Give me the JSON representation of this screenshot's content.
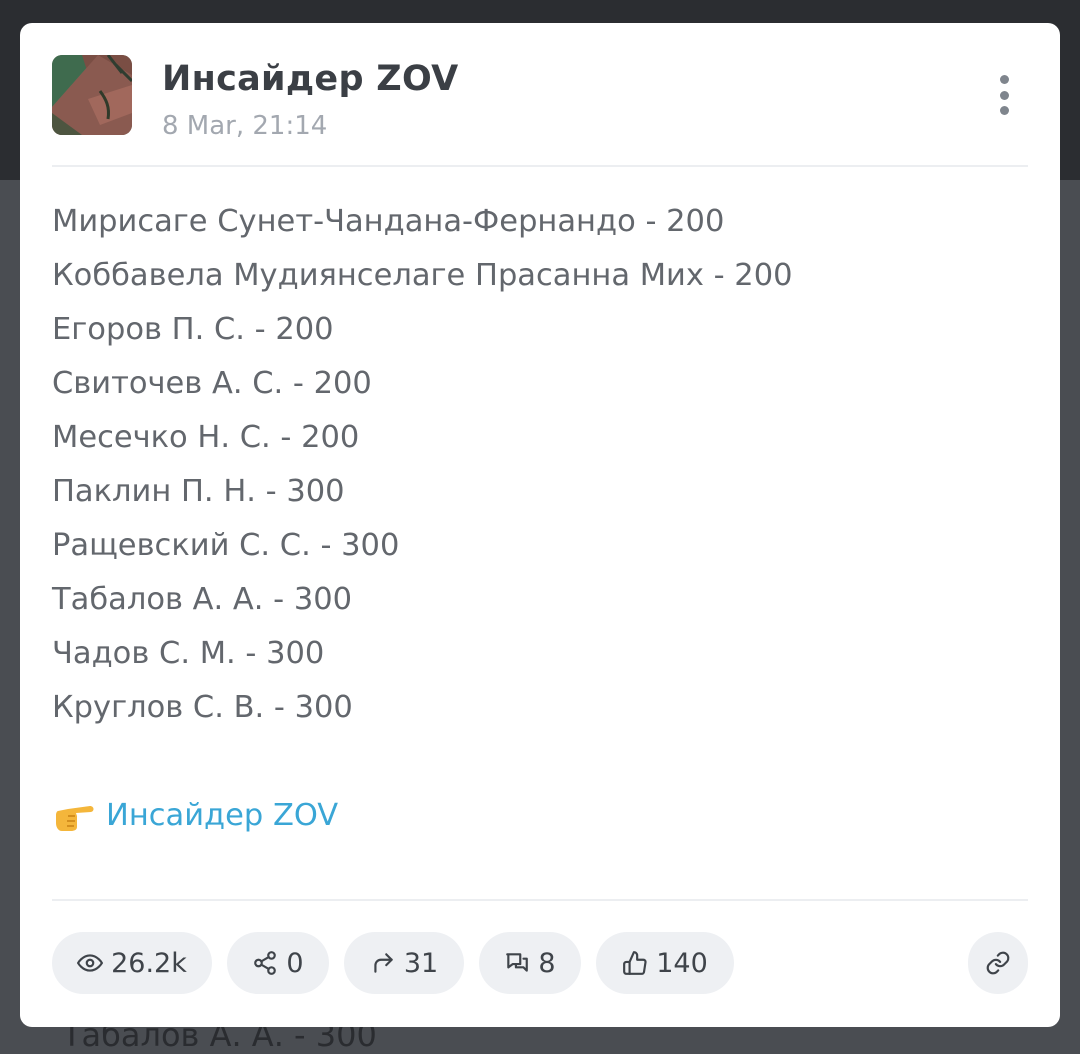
{
  "channel": {
    "name": "Инсайдер ZOV",
    "time": "8 Mar, 21:14"
  },
  "post": {
    "lines": [
      "Мирисаге Сунет-Чандана-Фернандо - 200",
      "Коббавела Мудиянселаге Прасанна Мих - 200",
      "Егоров П. С. - 200",
      "Свиточев А. С. - 200",
      "Месечко Н. С. - 200",
      "Паклин П. Н. - 300",
      "Ращевский С. С. - 300",
      "Табалов А. А. - 300",
      "Чадов С. М. - 300",
      "Круглов С. В. - 300"
    ],
    "source_link_text": "Инсайдер ZOV",
    "source_link_icon": "pointing-right-emoji"
  },
  "stats": {
    "views": "26.2k",
    "shares": "0",
    "forwards": "31",
    "comments": "8",
    "reactions": "140"
  },
  "icons": {
    "views": "eye-icon",
    "shares": "share-icon",
    "forwards": "forward-arrow-icon",
    "comments": "comments-icon",
    "reactions": "thumbs-up-icon",
    "link": "link-icon",
    "menu": "more-vertical-icon"
  },
  "background": {
    "partial_text": "Табалов А. А. - 300"
  },
  "colors": {
    "link": "#3aa6d6",
    "card": "#ffffff",
    "pill": "#eef0f3",
    "text": "#63676d"
  }
}
